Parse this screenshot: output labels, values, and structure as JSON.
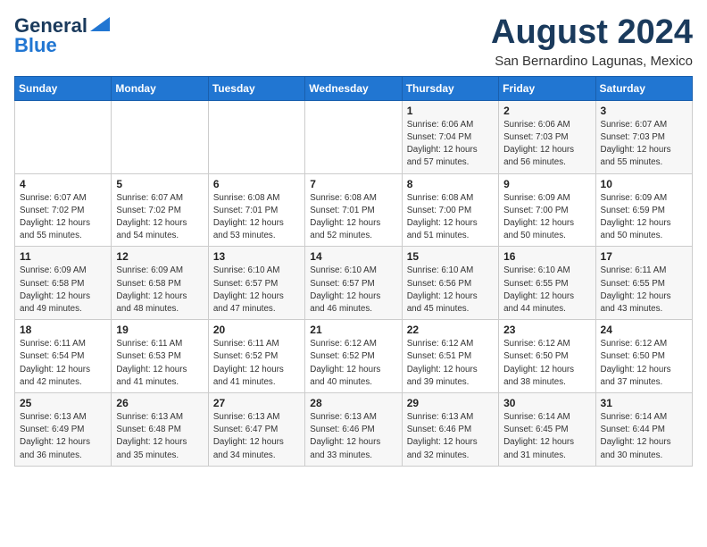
{
  "header": {
    "logo_line1": "General",
    "logo_line2": "Blue",
    "month_title": "August 2024",
    "subtitle": "San Bernardino Lagunas, Mexico"
  },
  "weekdays": [
    "Sunday",
    "Monday",
    "Tuesday",
    "Wednesday",
    "Thursday",
    "Friday",
    "Saturday"
  ],
  "weeks": [
    [
      {
        "day": "",
        "info": ""
      },
      {
        "day": "",
        "info": ""
      },
      {
        "day": "",
        "info": ""
      },
      {
        "day": "",
        "info": ""
      },
      {
        "day": "1",
        "info": "Sunrise: 6:06 AM\nSunset: 7:04 PM\nDaylight: 12 hours\nand 57 minutes."
      },
      {
        "day": "2",
        "info": "Sunrise: 6:06 AM\nSunset: 7:03 PM\nDaylight: 12 hours\nand 56 minutes."
      },
      {
        "day": "3",
        "info": "Sunrise: 6:07 AM\nSunset: 7:03 PM\nDaylight: 12 hours\nand 55 minutes."
      }
    ],
    [
      {
        "day": "4",
        "info": "Sunrise: 6:07 AM\nSunset: 7:02 PM\nDaylight: 12 hours\nand 55 minutes."
      },
      {
        "day": "5",
        "info": "Sunrise: 6:07 AM\nSunset: 7:02 PM\nDaylight: 12 hours\nand 54 minutes."
      },
      {
        "day": "6",
        "info": "Sunrise: 6:08 AM\nSunset: 7:01 PM\nDaylight: 12 hours\nand 53 minutes."
      },
      {
        "day": "7",
        "info": "Sunrise: 6:08 AM\nSunset: 7:01 PM\nDaylight: 12 hours\nand 52 minutes."
      },
      {
        "day": "8",
        "info": "Sunrise: 6:08 AM\nSunset: 7:00 PM\nDaylight: 12 hours\nand 51 minutes."
      },
      {
        "day": "9",
        "info": "Sunrise: 6:09 AM\nSunset: 7:00 PM\nDaylight: 12 hours\nand 50 minutes."
      },
      {
        "day": "10",
        "info": "Sunrise: 6:09 AM\nSunset: 6:59 PM\nDaylight: 12 hours\nand 50 minutes."
      }
    ],
    [
      {
        "day": "11",
        "info": "Sunrise: 6:09 AM\nSunset: 6:58 PM\nDaylight: 12 hours\nand 49 minutes."
      },
      {
        "day": "12",
        "info": "Sunrise: 6:09 AM\nSunset: 6:58 PM\nDaylight: 12 hours\nand 48 minutes."
      },
      {
        "day": "13",
        "info": "Sunrise: 6:10 AM\nSunset: 6:57 PM\nDaylight: 12 hours\nand 47 minutes."
      },
      {
        "day": "14",
        "info": "Sunrise: 6:10 AM\nSunset: 6:57 PM\nDaylight: 12 hours\nand 46 minutes."
      },
      {
        "day": "15",
        "info": "Sunrise: 6:10 AM\nSunset: 6:56 PM\nDaylight: 12 hours\nand 45 minutes."
      },
      {
        "day": "16",
        "info": "Sunrise: 6:10 AM\nSunset: 6:55 PM\nDaylight: 12 hours\nand 44 minutes."
      },
      {
        "day": "17",
        "info": "Sunrise: 6:11 AM\nSunset: 6:55 PM\nDaylight: 12 hours\nand 43 minutes."
      }
    ],
    [
      {
        "day": "18",
        "info": "Sunrise: 6:11 AM\nSunset: 6:54 PM\nDaylight: 12 hours\nand 42 minutes."
      },
      {
        "day": "19",
        "info": "Sunrise: 6:11 AM\nSunset: 6:53 PM\nDaylight: 12 hours\nand 41 minutes."
      },
      {
        "day": "20",
        "info": "Sunrise: 6:11 AM\nSunset: 6:52 PM\nDaylight: 12 hours\nand 41 minutes."
      },
      {
        "day": "21",
        "info": "Sunrise: 6:12 AM\nSunset: 6:52 PM\nDaylight: 12 hours\nand 40 minutes."
      },
      {
        "day": "22",
        "info": "Sunrise: 6:12 AM\nSunset: 6:51 PM\nDaylight: 12 hours\nand 39 minutes."
      },
      {
        "day": "23",
        "info": "Sunrise: 6:12 AM\nSunset: 6:50 PM\nDaylight: 12 hours\nand 38 minutes."
      },
      {
        "day": "24",
        "info": "Sunrise: 6:12 AM\nSunset: 6:50 PM\nDaylight: 12 hours\nand 37 minutes."
      }
    ],
    [
      {
        "day": "25",
        "info": "Sunrise: 6:13 AM\nSunset: 6:49 PM\nDaylight: 12 hours\nand 36 minutes."
      },
      {
        "day": "26",
        "info": "Sunrise: 6:13 AM\nSunset: 6:48 PM\nDaylight: 12 hours\nand 35 minutes."
      },
      {
        "day": "27",
        "info": "Sunrise: 6:13 AM\nSunset: 6:47 PM\nDaylight: 12 hours\nand 34 minutes."
      },
      {
        "day": "28",
        "info": "Sunrise: 6:13 AM\nSunset: 6:46 PM\nDaylight: 12 hours\nand 33 minutes."
      },
      {
        "day": "29",
        "info": "Sunrise: 6:13 AM\nSunset: 6:46 PM\nDaylight: 12 hours\nand 32 minutes."
      },
      {
        "day": "30",
        "info": "Sunrise: 6:14 AM\nSunset: 6:45 PM\nDaylight: 12 hours\nand 31 minutes."
      },
      {
        "day": "31",
        "info": "Sunrise: 6:14 AM\nSunset: 6:44 PM\nDaylight: 12 hours\nand 30 minutes."
      }
    ]
  ]
}
